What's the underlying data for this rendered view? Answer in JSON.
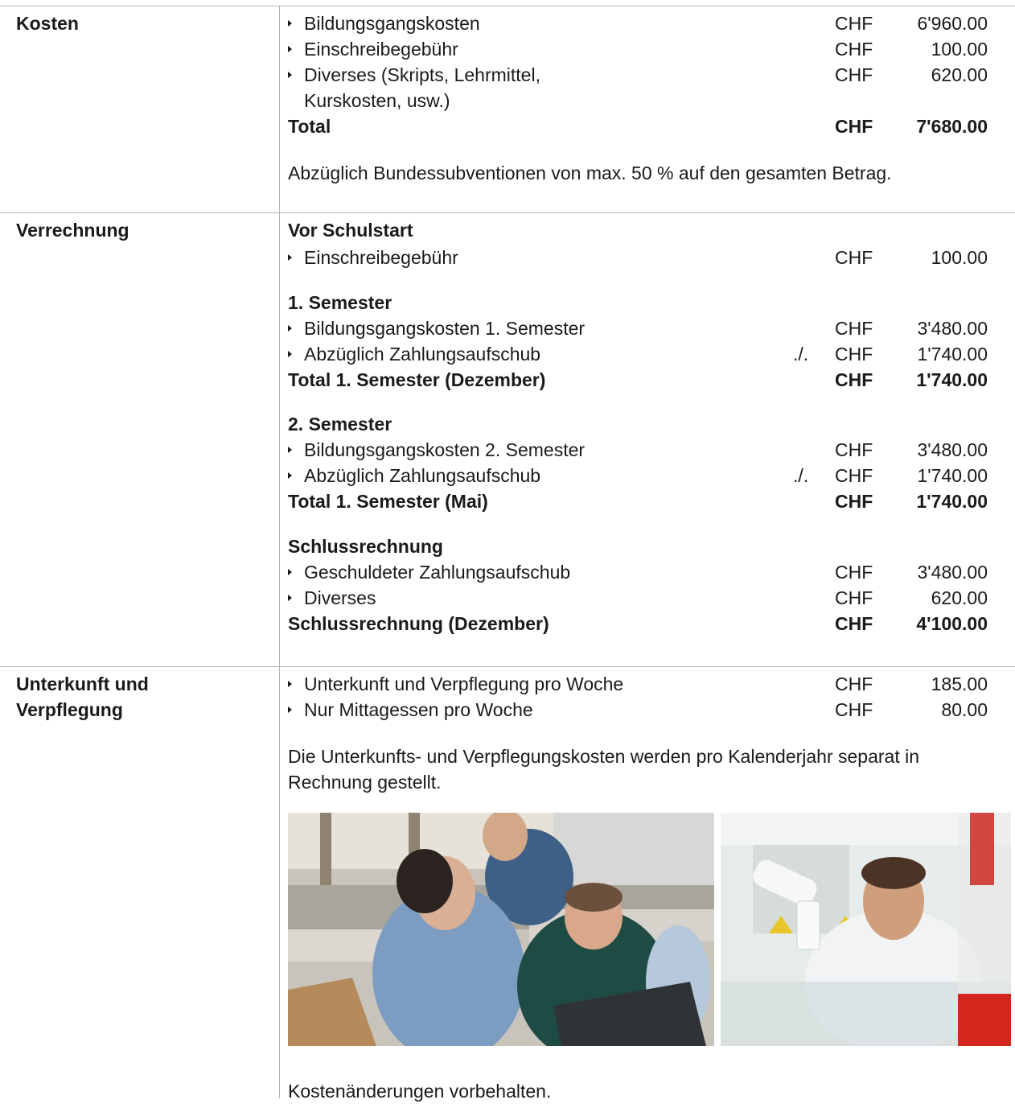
{
  "kosten": {
    "label": "Kosten",
    "items": [
      {
        "text": "Bildungsgangskosten",
        "currency": "CHF",
        "amount": "6'960.00"
      },
      {
        "text": "Einschreibegebühr",
        "currency": "CHF",
        "amount": "100.00"
      },
      {
        "text": "Diverses (Skripts, Lehrmittel,",
        "text2": "Kurskosten, usw.)",
        "currency": "CHF",
        "amount": "620.00"
      }
    ],
    "total": {
      "label": "Total",
      "currency": "CHF",
      "amount": "7'680.00"
    },
    "note": "Abzüglich Bundessubventionen von max. 50 % auf den gesamten Betrag."
  },
  "verrechnung": {
    "label": "Verrechnung",
    "vor": {
      "heading": "Vor Schulstart",
      "item": {
        "text": "Einschreibegebühr",
        "currency": "CHF",
        "amount": "100.00"
      }
    },
    "sem1": {
      "heading": "1. Semester",
      "items": [
        {
          "text": "Bildungsgangskosten 1. Semester",
          "prefix": "",
          "currency": "CHF",
          "amount": "3'480.00"
        },
        {
          "text": "Abzüglich Zahlungsaufschub",
          "prefix": "./.",
          "currency": "CHF",
          "amount": "1'740.00"
        }
      ],
      "total": {
        "label": "Total 1. Semester (Dezember)",
        "currency": "CHF",
        "amount": "1'740.00"
      }
    },
    "sem2": {
      "heading": "2. Semester",
      "items": [
        {
          "text": "Bildungsgangskosten 2. Semester",
          "prefix": "",
          "currency": "CHF",
          "amount": "3'480.00"
        },
        {
          "text": "Abzüglich Zahlungsaufschub",
          "prefix": "./.",
          "currency": "CHF",
          "amount": "1'740.00"
        }
      ],
      "total": {
        "label": "Total 1. Semester (Mai)",
        "currency": "CHF",
        "amount": "1'740.00"
      }
    },
    "schluss": {
      "heading": "Schlussrechnung",
      "items": [
        {
          "text": "Geschuldeter Zahlungsaufschub",
          "currency": "CHF",
          "amount": "3'480.00"
        },
        {
          "text": "Diverses",
          "currency": "CHF",
          "amount": "620.00"
        }
      ],
      "total": {
        "label": "Schlussrechnung (Dezember)",
        "currency": "CHF",
        "amount": "4'100.00"
      }
    }
  },
  "unterkunft": {
    "label1": "Unterkunft und",
    "label2": "Verpflegung",
    "items": [
      {
        "text": "Unterkunft und Verpflegung pro Woche",
        "currency": "CHF",
        "amount": "185.00"
      },
      {
        "text": "Nur Mittagessen pro Woche",
        "currency": "CHF",
        "amount": "80.00"
      }
    ],
    "note1": "Die Unterkunfts- und Verpflegungskosten werden pro Kalenderjahr separat in",
    "note2": "Rechnung gestellt."
  },
  "footer": "Kostenänderungen vorbehalten."
}
